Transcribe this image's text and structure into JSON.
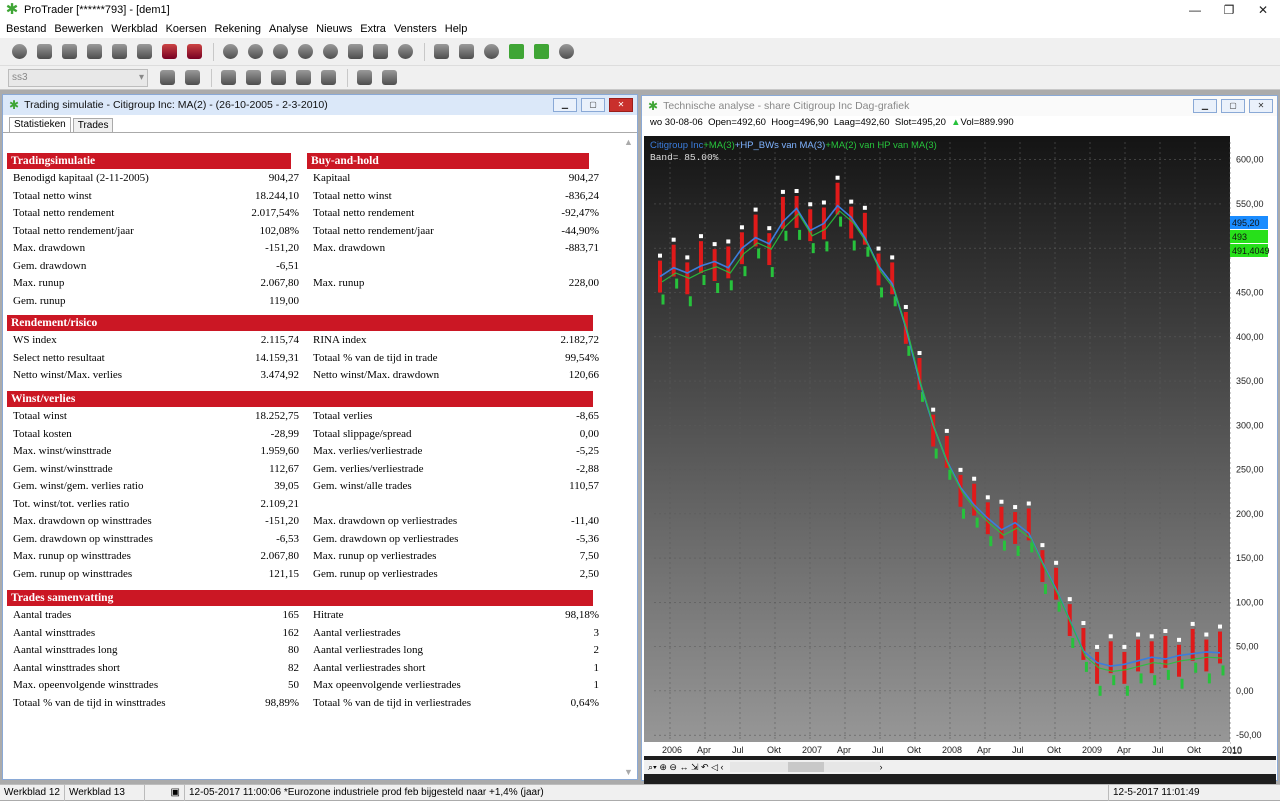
{
  "app": {
    "title": "ProTrader [******793] - [dem1]"
  },
  "menu": [
    "Bestand",
    "Bewerken",
    "Werkblad",
    "Koersen",
    "Rekening",
    "Analyse",
    "Nieuws",
    "Extra",
    "Vensters",
    "Help"
  ],
  "toolbar2": {
    "combo_value": "ss3"
  },
  "sim": {
    "title": "Trading simulatie - Citigroup Inc: MA(2) - (26-10-2005 - 2-3-2010)",
    "tabs": [
      "Statistieken",
      "Trades"
    ],
    "sections": [
      {
        "left_title": "Tradingsimulatie",
        "right_title": "Buy-and-hold",
        "rows": [
          [
            "Benodigd kapitaal (2-11-2005)",
            "904,27",
            "Kapitaal",
            "904,27"
          ],
          [
            "Totaal netto winst",
            "18.244,10",
            "Totaal netto winst",
            "-836,24"
          ],
          [
            "Totaal netto rendement",
            "2.017,54%",
            "Totaal netto rendement",
            "-92,47%"
          ],
          [
            "Totaal netto rendement/jaar",
            "102,08%",
            "Totaal netto rendement/jaar",
            "-44,90%"
          ],
          [
            "Max. drawdown",
            "-151,20",
            "Max. drawdown",
            "-883,71"
          ],
          [
            "Gem. drawdown",
            "-6,51",
            "",
            ""
          ],
          [
            "Max. runup",
            "2.067,80",
            "Max. runup",
            "228,00"
          ],
          [
            "Gem. runup",
            "119,00",
            "",
            ""
          ]
        ]
      },
      {
        "left_title": "Rendement/risico",
        "right_title": "",
        "rows": [
          [
            "WS index",
            "2.115,74",
            "RINA index",
            "2.182,72"
          ],
          [
            "Select netto resultaat",
            "14.159,31",
            "Totaal % van de tijd in trade",
            "99,54%"
          ],
          [
            "Netto winst/Max. verlies",
            "3.474,92",
            "Netto winst/Max. drawdown",
            "120,66"
          ]
        ]
      },
      {
        "left_title": "Winst/verlies",
        "right_title": "",
        "rows": [
          [
            "Totaal winst",
            "18.252,75",
            "Totaal verlies",
            "-8,65"
          ],
          [
            "Totaal kosten",
            "-28,99",
            "Totaal slippage/spread",
            "0,00"
          ],
          [
            "Max. winst/winsttrade",
            "1.959,60",
            "Max. verlies/verliestrade",
            "-5,25"
          ],
          [
            "Gem. winst/winsttrade",
            "112,67",
            "Gem. verlies/verliestrade",
            "-2,88"
          ],
          [
            "Gem. winst/gem. verlies ratio",
            "39,05",
            "Gem. winst/alle trades",
            "110,57"
          ],
          [
            "Tot. winst/tot. verlies ratio",
            "2.109,21",
            "",
            ""
          ],
          [
            "Max. drawdown op winsttrades",
            "-151,20",
            "Max. drawdown op verliestrades",
            "-11,40"
          ],
          [
            "Gem. drawdown op winsttrades",
            "-6,53",
            "Gem. drawdown op verliestrades",
            "-5,36"
          ],
          [
            "Max. runup op winsttrades",
            "2.067,80",
            "Max. runup op verliestrades",
            "7,50"
          ],
          [
            "Gem. runup op winsttrades",
            "121,15",
            "Gem. runup op verliestrades",
            "2,50"
          ]
        ]
      },
      {
        "left_title": "Trades samenvatting",
        "right_title": "",
        "rows": [
          [
            "Aantal trades",
            "165",
            "Hitrate",
            "98,18%"
          ],
          [
            "Aantal winsttrades",
            "162",
            "Aantal verliestrades",
            "3"
          ],
          [
            "Aantal winsttrades long",
            "80",
            "Aantal verliestrades long",
            "2"
          ],
          [
            "Aantal winsttrades short",
            "82",
            "Aantal verliestrades short",
            "1"
          ],
          [
            "Max. opeenvolgende winsttrades",
            "50",
            "Max opeenvolgende verliestrades",
            "1"
          ],
          [
            "Totaal % van de tijd in winsttrades",
            "98,89%",
            "Totaal % van de tijd in verliestrades",
            "0,64%"
          ]
        ]
      }
    ]
  },
  "chartwin": {
    "title": "Technische analyse - share Citigroup Inc Dag-grafiek",
    "info": {
      "date": "wo 30-08-06",
      "open": "Open=492,60",
      "high": "Hoog=496,90",
      "low": "Laag=492,60",
      "close": "Slot=495,20",
      "vol": "Vol=889.990"
    },
    "legend": {
      "a": "Citigroup Inc",
      "b": "+MA(3)",
      "c": "+HP_BWs van MA(3)",
      "d": "+MA(2) van HP van MA(3)",
      "band": "Band= 85.00%"
    },
    "tags": [
      "495,20",
      "493",
      "491,4049"
    ]
  },
  "chart_data": {
    "type": "line",
    "title": "",
    "x_ticks": [
      "2006",
      "Apr",
      "Jul",
      "Okt",
      "2007",
      "Apr",
      "Jul",
      "Okt",
      "2008",
      "Apr",
      "Jul",
      "Okt",
      "2009",
      "Apr",
      "Jul",
      "Okt",
      "2010"
    ],
    "y_ticks": [
      "600,00",
      "550,00",
      "500,00",
      "450,00",
      "400,00",
      "350,00",
      "300,00",
      "250,00",
      "200,00",
      "150,00",
      "100,00",
      "50,00",
      "0,00",
      "-50,00"
    ],
    "ylim": [
      -60,
      620
    ],
    "series": [
      {
        "name": "Citigroup Inc",
        "values": [
          468,
          478,
          472,
          480,
          485,
          478,
          500,
          512,
          505,
          530,
          545,
          520,
          528,
          548,
          535,
          512,
          480,
          460,
          410,
          350,
          300,
          260,
          230,
          210,
          195,
          182,
          190,
          178,
          145,
          115,
          80,
          45,
          32,
          28,
          30,
          34,
          38,
          36,
          40,
          42,
          44,
          43
        ]
      }
    ],
    "colors": {
      "close": "#3b7ddd",
      "high": "#ffffff",
      "low": "#27c23c",
      "band": "#e01a1a",
      "ma": "#1a8cff"
    }
  },
  "status": {
    "tabs": [
      "Werkblad 12",
      "Werkblad 13"
    ],
    "news": "12-05-2017 11:00:06 *Eurozone industriele prod feb bijgesteld naar +1,4% (jaar)",
    "clock": "12-5-2017 11:01:49"
  }
}
